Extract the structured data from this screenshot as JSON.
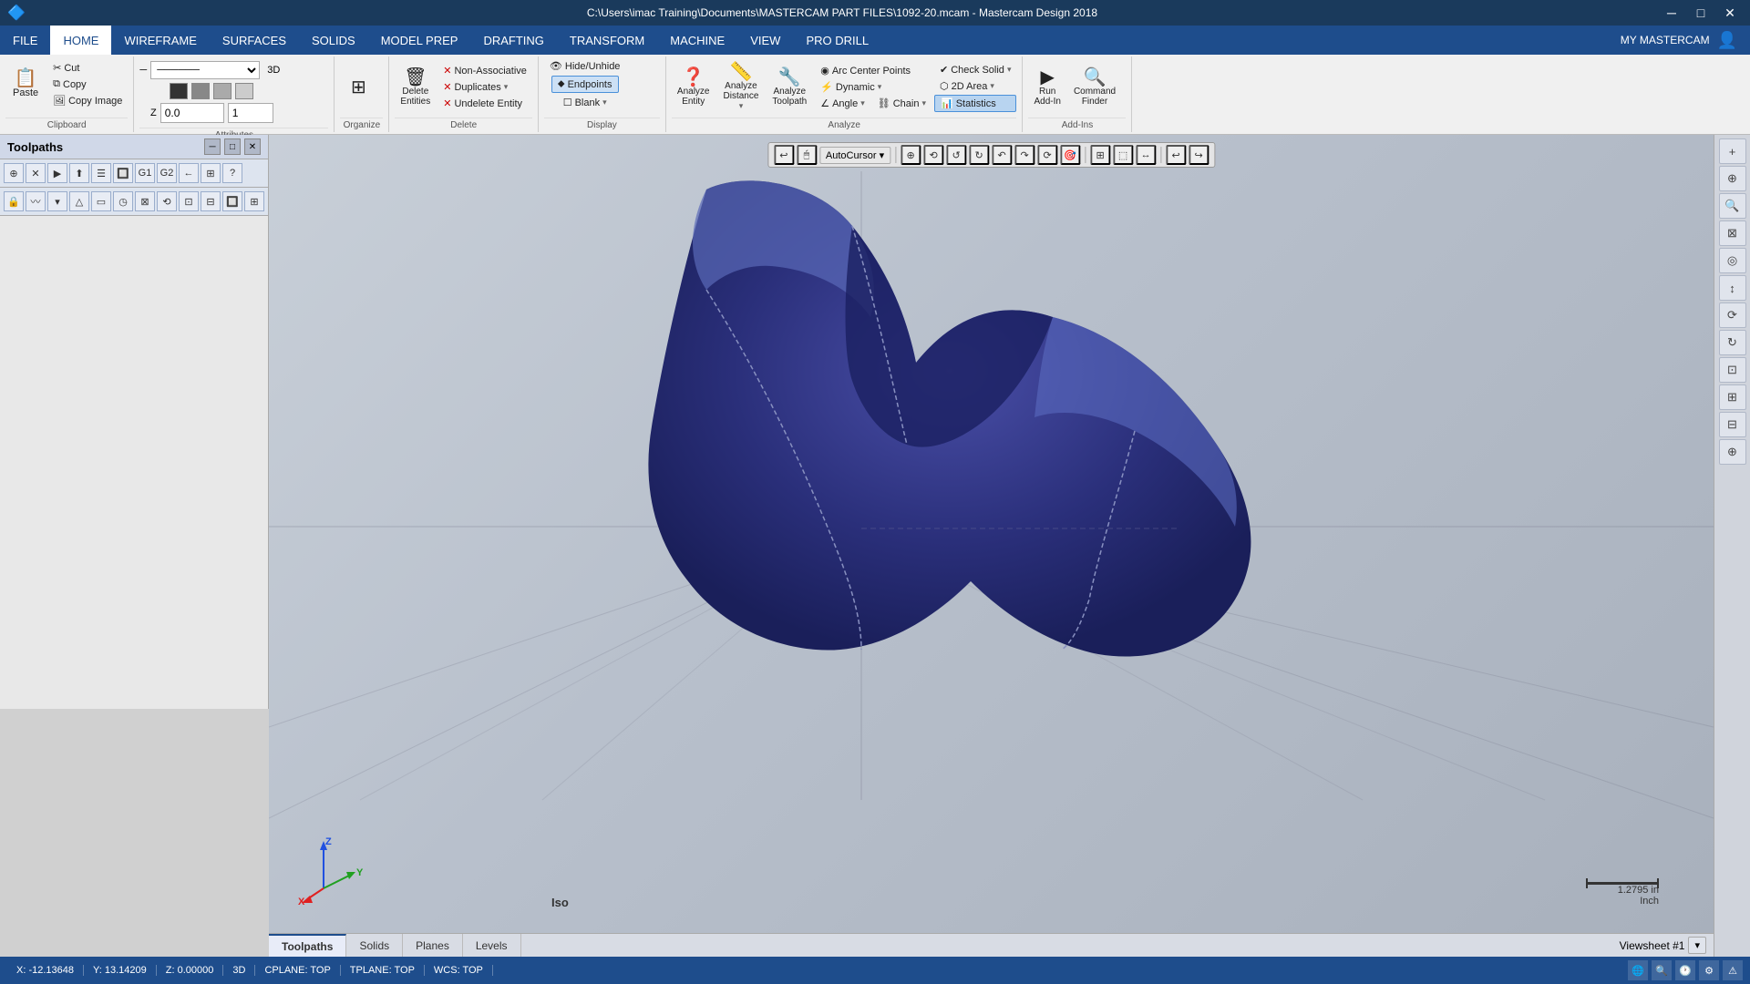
{
  "titlebar": {
    "title": "C:\\Users\\imac Training\\Documents\\MASTERCAM PART FILES\\1092-20.mcam - Mastercam Design 2018",
    "minimize": "─",
    "maximize": "□",
    "close": "✕"
  },
  "menubar": {
    "items": [
      "FILE",
      "HOME",
      "WIREFRAME",
      "SURFACES",
      "SOLIDS",
      "MODEL PREP",
      "DRAFTING",
      "TRANSFORM",
      "MACHINE",
      "VIEW",
      "PRO DRILL"
    ],
    "active": "HOME",
    "right_label": "MY MASTERCAM"
  },
  "ribbon": {
    "clipboard_group": "Clipboard",
    "cut_label": "Cut",
    "copy_label": "Copy",
    "copy_image_label": "Copy Image",
    "paste_label": "Paste",
    "attributes_group": "Attributes",
    "organize_group": "Organize",
    "delete_group": "Delete",
    "delete_entities_label": "Delete\nEntities",
    "undelete_entity_label": "Undelete Entity",
    "duplicates_label": "Duplicates",
    "non_associative_label": "Non-Associative",
    "display_group": "Display",
    "hide_hidehide_label": "Hide/Unhide",
    "endpoints_label": "Endpoints",
    "blank_label": "Blank",
    "analyze_group": "Analyze",
    "analyze_entity_label": "Analyze\nEntity",
    "analyze_distance_label": "Analyze\nDistance",
    "analyze_toolpath_label": "Analyze\nToolpath",
    "arc_center_points_label": "Arc Center Points",
    "dynamic_label": "Dynamic",
    "angle_label": "Angle",
    "chain_label": "Chain",
    "check_solid_label": "Check Solid",
    "2d_area_label": "2D Area",
    "statistics_label": "Statistics",
    "addins_group": "Add-Ins",
    "run_addin_label": "Run\nAdd-In",
    "command_finder_label": "Command\nFinder",
    "z_value": "0.0",
    "num_value": "1",
    "3d_label": "3D"
  },
  "toolpaths_panel": {
    "title": "Toolpaths",
    "minimize_btn": "─",
    "float_btn": "□",
    "close_btn": "✕"
  },
  "secondary_toolbar": {
    "autocursor_label": "AutoCursor ▾"
  },
  "viewport": {
    "view_label": "Iso",
    "scale_value": "1.2795 in",
    "scale_unit": "Inch"
  },
  "tabbar": {
    "tabs": [
      "Toolpaths",
      "Solids",
      "Planes",
      "Levels"
    ],
    "active_tab": "Toolpaths",
    "viewsheet_label": "Viewsheet #1",
    "viewsheet_arrow": "▾"
  },
  "statusbar": {
    "x_label": "X:",
    "x_value": "-12.13648",
    "y_label": "Y:",
    "y_value": "13.14209",
    "z_label": "Z:",
    "z_value": "0.00000",
    "mode": "3D",
    "cplane": "CPLANE: TOP",
    "tplane": "TPLANE: TOP",
    "wcs": "WCS: TOP"
  },
  "axes": {
    "x_color": "#e02020",
    "y_color": "#20a020",
    "z_color": "#2050e0"
  }
}
